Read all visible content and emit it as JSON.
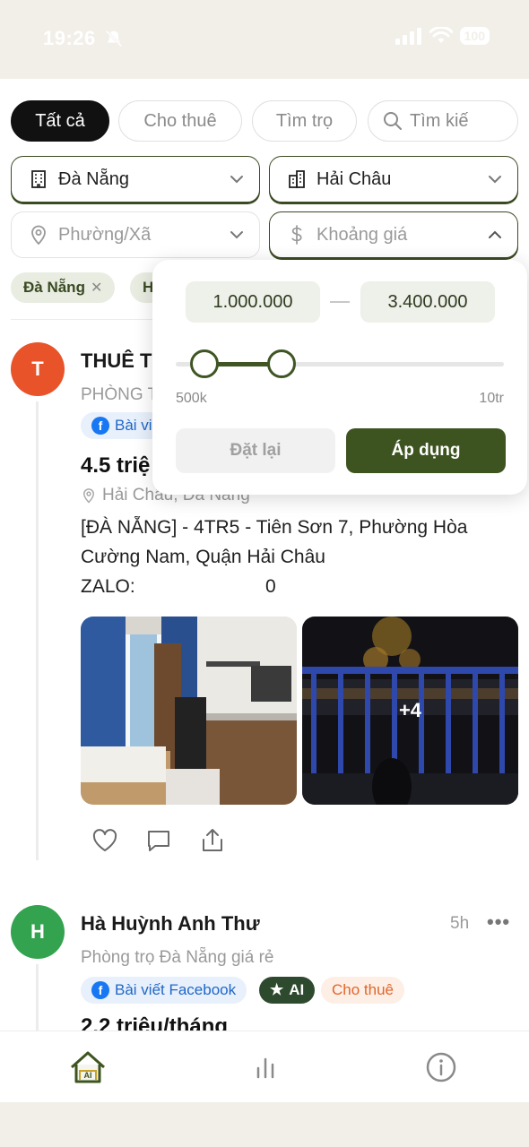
{
  "status_bar": {
    "time": "19:26",
    "battery": "100"
  },
  "filters": {
    "tabs": [
      {
        "label": "Tất cả",
        "active": true
      },
      {
        "label": "Cho thuê",
        "active": false
      },
      {
        "label": "Tìm trọ",
        "active": false
      }
    ],
    "search_placeholder": "Tìm kiế",
    "city": "Đà Nẵng",
    "district": "Hải Châu",
    "ward_placeholder": "Phường/Xã",
    "price_placeholder": "Khoảng giá",
    "chips": [
      {
        "label": "Đà Nẵng"
      },
      {
        "label": "H"
      }
    ]
  },
  "price_popup": {
    "min_value": "1.000.000",
    "max_value": "3.400.000",
    "range_min_label": "500k",
    "range_max_label": "10tr",
    "reset_label": "Đặt lại",
    "apply_label": "Áp dụng"
  },
  "posts": [
    {
      "avatar_letter": "T",
      "avatar_color": "#e8532a",
      "title": "THUÊ T",
      "subtitle": "PHÒNG T",
      "badge_fb": "Bài vi",
      "price": "4.5 triệ",
      "location": "Hải Châu, Đà Nẵng",
      "description_lines": [
        "[ĐÀ NẴNG] - 4TR5 - Tiên Sơn 7, Phường Hòa",
        "Cường Nam, Quận Hải Châu"
      ],
      "zalo_label": "ZALO:",
      "zalo_value": "0",
      "more_photos": "+4"
    },
    {
      "avatar_letter": "H",
      "avatar_color": "#34a34f",
      "title": "Hà Huỳnh Anh Thư",
      "time": "5h",
      "subtitle": "Phòng trọ Đà Nẵng giá rẻ",
      "badge_fb": "Bài viết Facebook",
      "badge_ai": "AI",
      "badge_rent": "Cho thuê",
      "price": "2.2 triệu/tháng"
    }
  ]
}
